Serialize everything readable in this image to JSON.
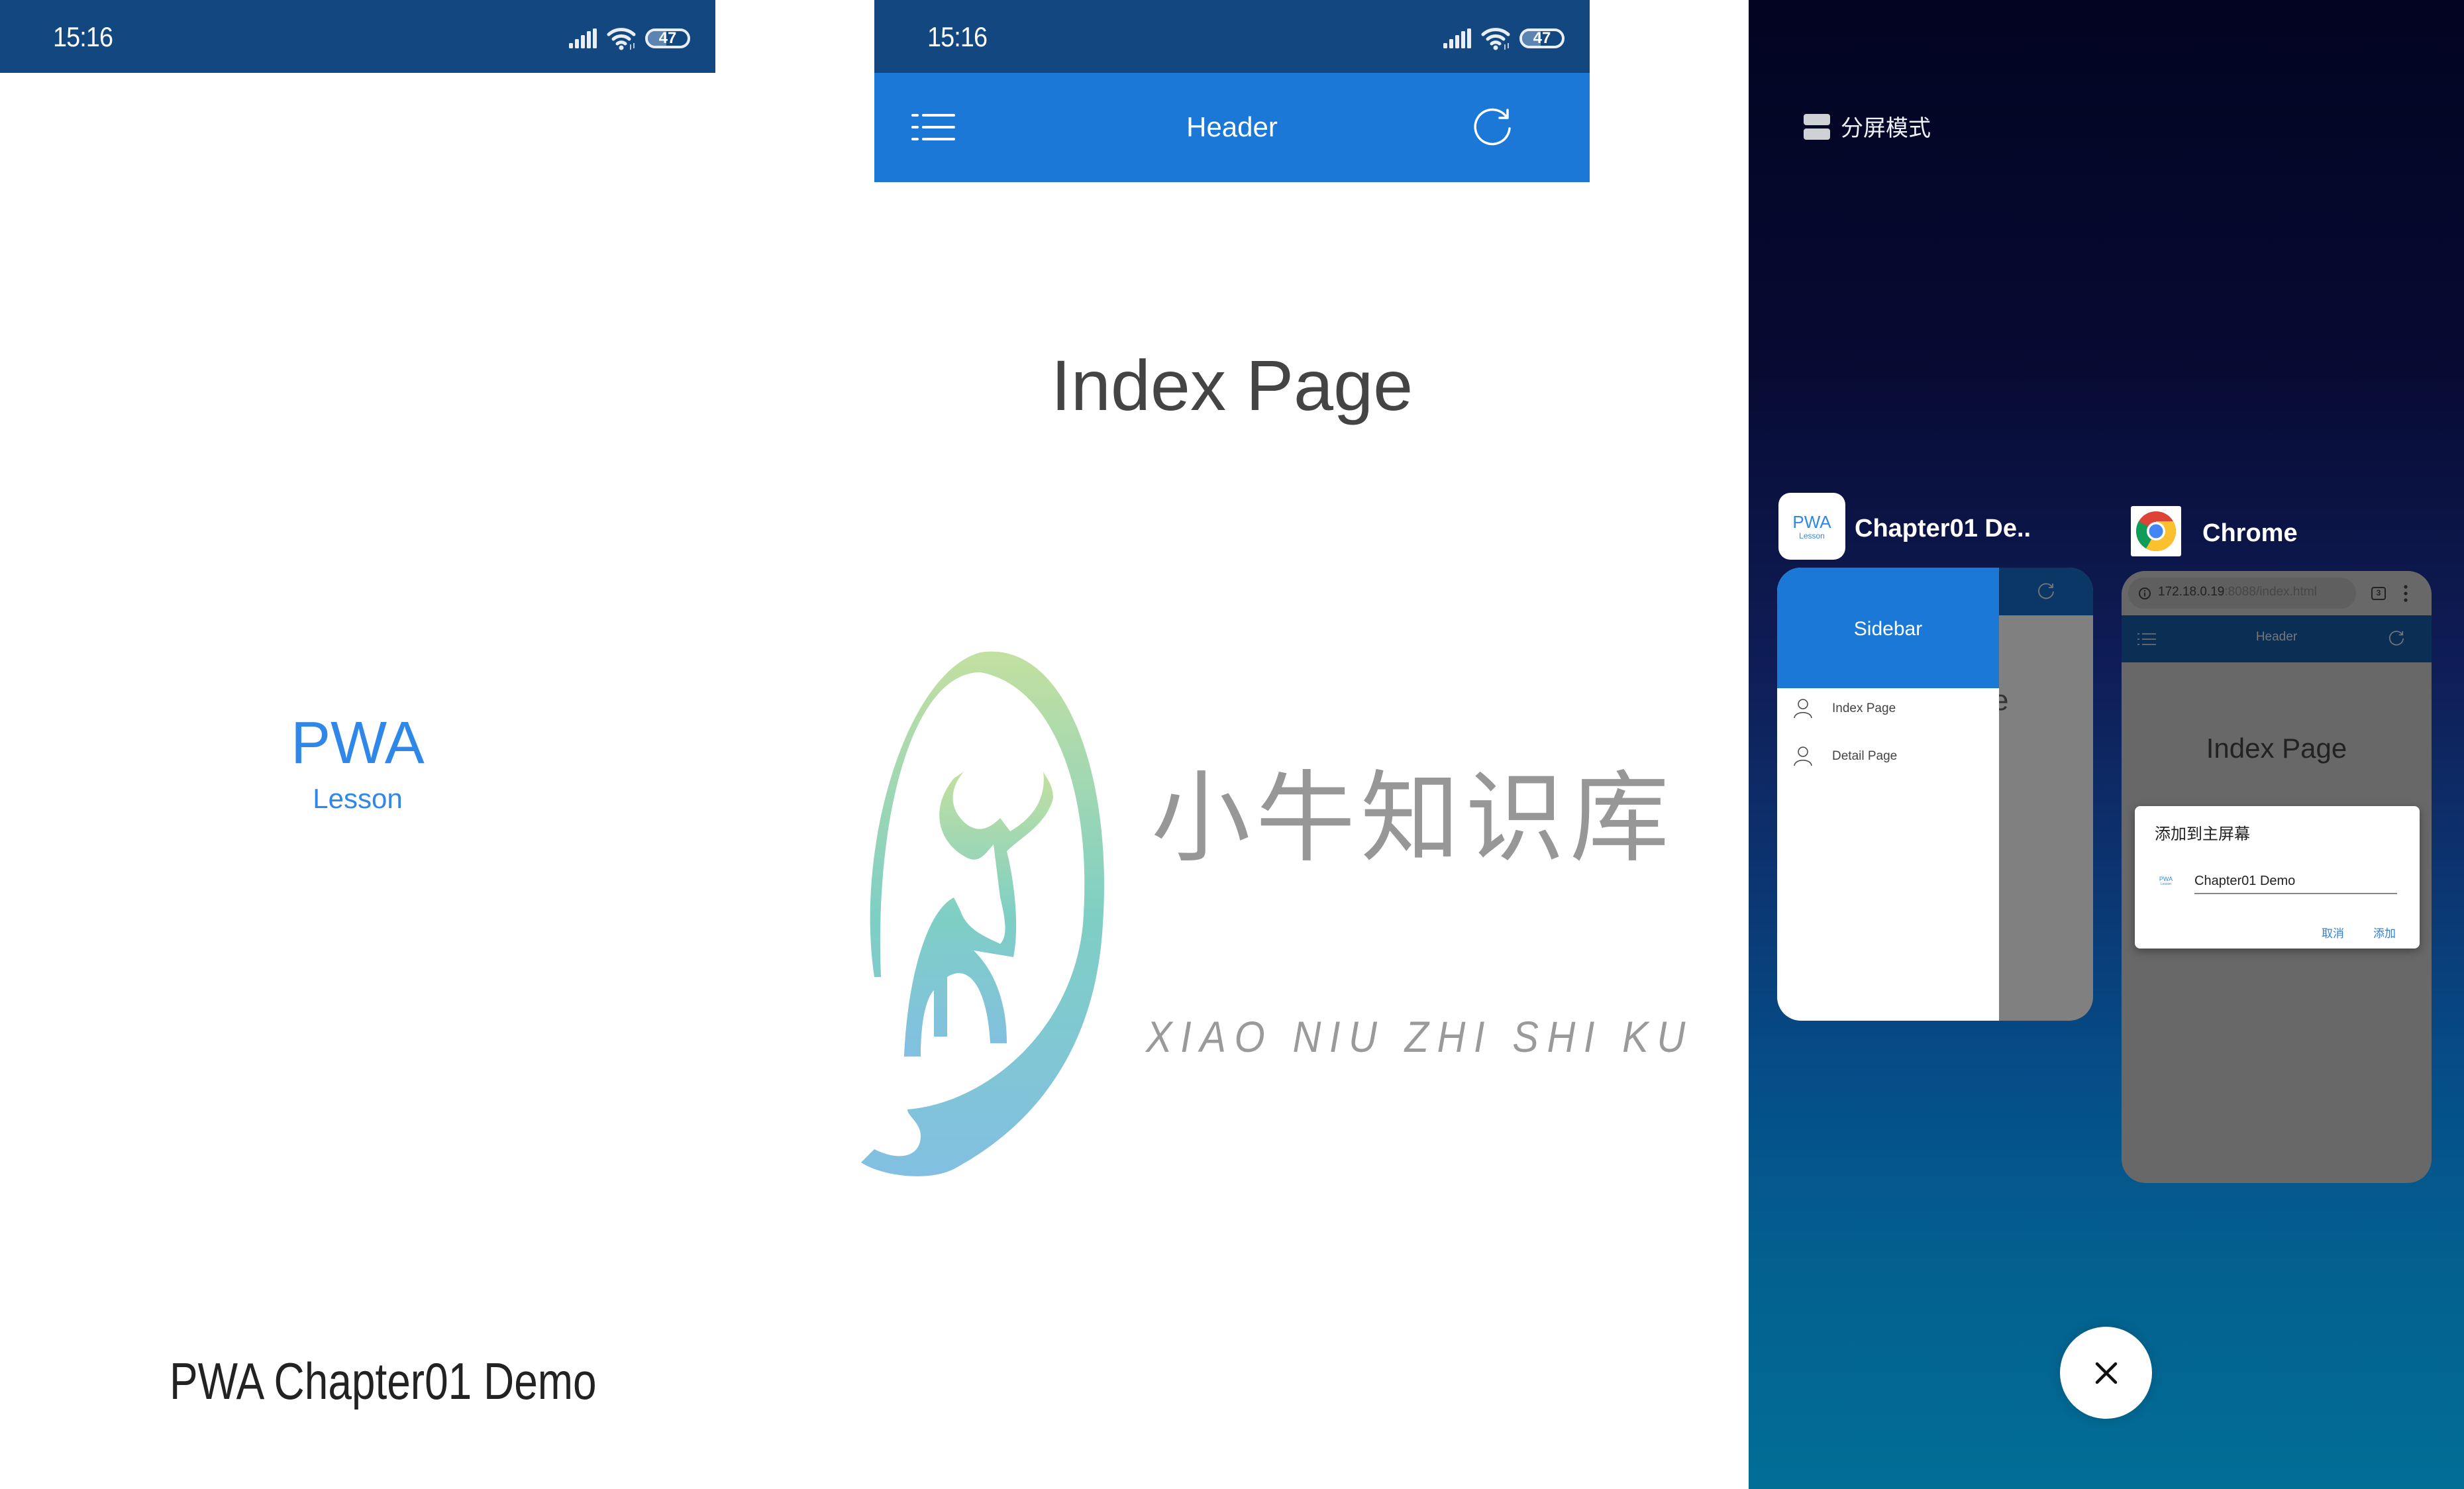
{
  "status_bar": {
    "time": "15:16",
    "battery_level": "47",
    "battery_fraction": 0.47,
    "icons": [
      "signal-icon",
      "wifi-icon",
      "battery-icon"
    ]
  },
  "splash": {
    "logo_title": "PWA",
    "logo_subtitle": "Lesson",
    "app_name": "PWA Chapter01 Demo",
    "brand_color": "#2f88e8"
  },
  "app_page": {
    "header": {
      "title": "Header",
      "menu_icon": "list-menu-icon",
      "refresh_icon": "refresh-icon",
      "color": "#1b78d6"
    },
    "page_title": "Index Page"
  },
  "watermark": {
    "chinese": "小牛知识库",
    "pinyin": "XIAO NIU ZHI SHI KU"
  },
  "recents": {
    "split_mode_label": "分屏模式",
    "cards": [
      {
        "app_label": "Chapter01 De..",
        "icon_title": "PWA",
        "icon_subtitle": "Lesson",
        "drawer_title": "Sidebar",
        "drawer_items": [
          {
            "label": "Index Page",
            "icon": "user-icon"
          },
          {
            "label": "Detail Page",
            "icon": "user-icon"
          }
        ],
        "background_partial_text": "e"
      },
      {
        "app_label": "Chrome",
        "url_host": "172.18.0.19",
        "url_path": ":8088/index.html",
        "tab_count": "3",
        "header_title": "Header",
        "page_title": "Index Page",
        "dialog": {
          "title": "添加到主屏幕",
          "icon_title": "PWA",
          "icon_subtitle": "Lesson",
          "name_value": "Chapter01 Demo",
          "cancel_label": "取消",
          "add_label": "添加"
        }
      }
    ],
    "close_all_icon": "close-icon"
  }
}
